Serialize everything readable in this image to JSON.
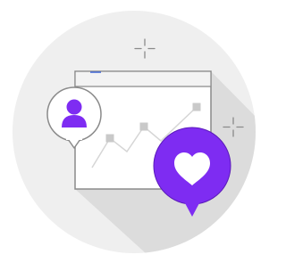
{
  "illustration": {
    "subject": "engagement",
    "icons": [
      "user-icon",
      "heart-icon",
      "sparkle-icon",
      "line-chart-icon"
    ],
    "colors": {
      "background_circle": "#efefef",
      "shadow": "#dcdcdc",
      "accent_purple": "#7e2cf2",
      "accent_purple_dark": "#5a1bb8",
      "outline_gray": "#8a8a8a",
      "light_gray": "#c9c9c9",
      "chart_line": "#d6d6d6",
      "window_header": "#f3f3f3",
      "header_dash": "#4b6fd8",
      "white": "#ffffff"
    }
  }
}
